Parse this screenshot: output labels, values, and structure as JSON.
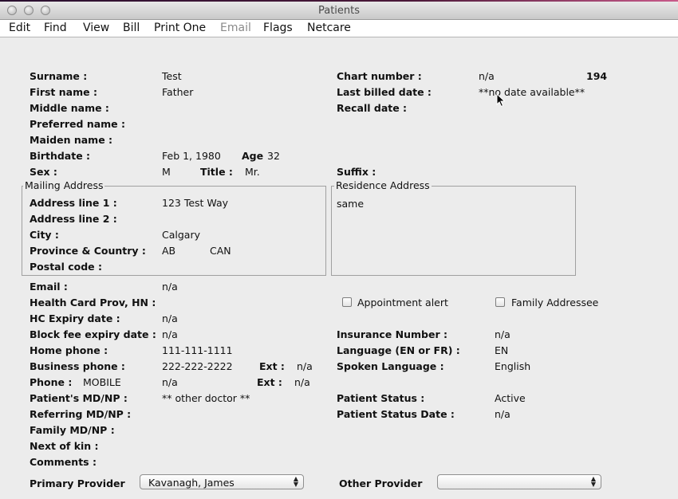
{
  "window": {
    "title": "Patients"
  },
  "menu": [
    "Edit",
    "Find",
    "View",
    "Bill",
    "Print One",
    "Email",
    "Flags",
    "Netcare"
  ],
  "patient": {
    "surname_label": "Surname :",
    "surname": "Test",
    "first_label": "First name :",
    "first": "Father",
    "middle_label": "Middle name :",
    "preferred_label": "Preferred name :",
    "maiden_label": "Maiden name :",
    "birthdate_label": "Birthdate :",
    "birthdate": "Feb 1, 1980",
    "age_label": "Age",
    "age": "32",
    "sex_label": "Sex :",
    "sex": "M",
    "title_label": "Title :",
    "title": "Mr.",
    "chart_label": "Chart number :",
    "chart": "n/a",
    "chart_id": "194",
    "lastbilled_label": "Last billed date :",
    "lastbilled": "**no date available**",
    "recall_label": "Recall date :",
    "suffix_label": "Suffix :"
  },
  "mailing": {
    "title": "Mailing Address",
    "line1_label": "Address line 1 :",
    "line1": "123 Test Way",
    "line2_label": "Address line 2 :",
    "city_label": "City :",
    "city": "Calgary",
    "prov_label": "Province & Country :",
    "prov": "AB",
    "country": "CAN",
    "postal_label": "Postal code :"
  },
  "residence": {
    "title": "Residence Address",
    "value": "same"
  },
  "contact": {
    "email_label": "Email :",
    "email": "n/a",
    "hc_label": "Health Card Prov, HN :",
    "hcexp_label": "HC Expiry date :",
    "hcexp": "n/a",
    "blockfee_label": "Block fee expiry date :",
    "blockfee": "n/a",
    "homephone_label": "Home phone :",
    "homephone": "111-111-1111",
    "bizphone_label": "Business phone :",
    "bizphone": "222-222-2222",
    "ext_label": "Ext :",
    "bizext": "n/a",
    "phone_label": "Phone :",
    "phone_type": "MOBILE",
    "phone": "n/a",
    "ext2_label": "Ext :",
    "phoneext": "n/a",
    "mdnp_label": "Patient's MD/NP :",
    "mdnp": "** other doctor **",
    "referring_label": "Referring MD/NP :",
    "family_label": "Family MD/NP :",
    "nextofkin_label": "Next of kin :",
    "comments_label": "Comments :"
  },
  "right": {
    "appt_alert": "Appointment alert",
    "family_addressee": "Family Addressee",
    "insurance_label": "Insurance Number :",
    "insurance": "n/a",
    "language_label": "Language (EN or FR) :",
    "language": "EN",
    "spoken_label": "Spoken Language :",
    "spoken": "English",
    "status_label": "Patient Status :",
    "status": "Active",
    "statusdate_label": "Patient Status Date :",
    "statusdate": "n/a"
  },
  "providers": {
    "primary_label": "Primary Provider",
    "primary": "Kavanagh, James",
    "other_label": "Other Provider",
    "other": ""
  }
}
